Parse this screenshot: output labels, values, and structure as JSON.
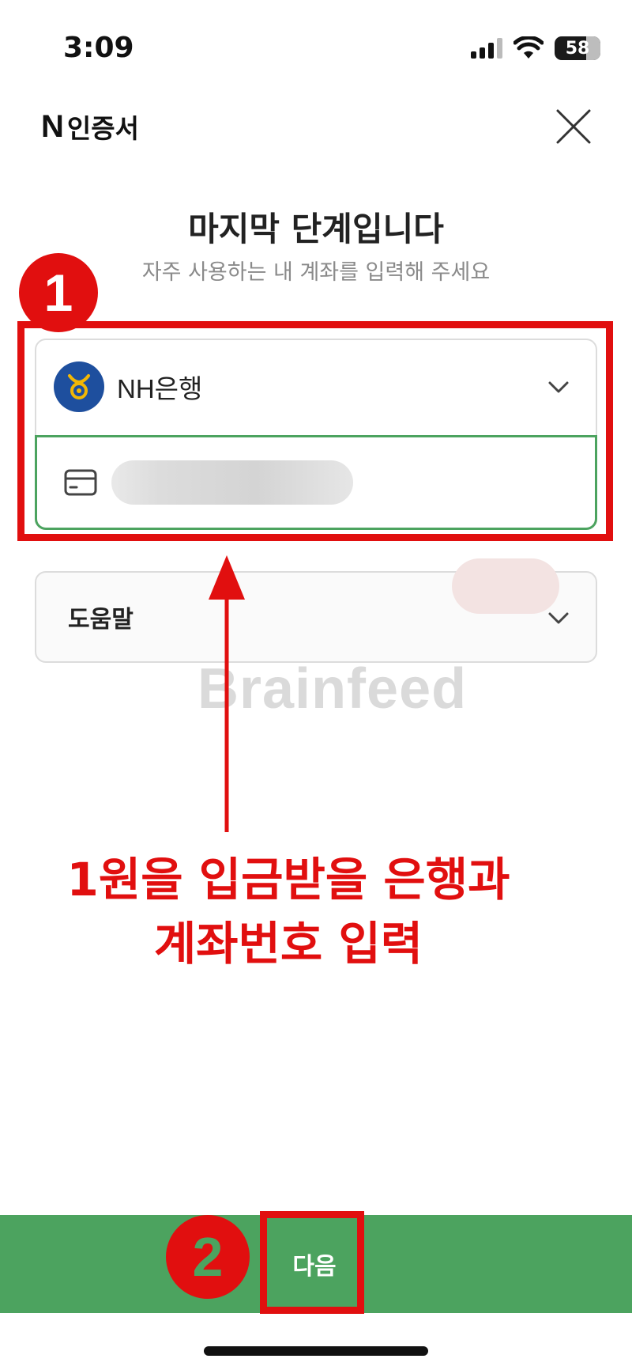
{
  "status_bar": {
    "time": "3:09",
    "battery": "58"
  },
  "header": {
    "logo_letter": "N",
    "title": "인증서"
  },
  "page": {
    "title": "마지막 단계입니다",
    "subtitle": "자주 사용하는 내 계좌를 입력해 주세요"
  },
  "form": {
    "bank_name": "NH은행",
    "account_number": ""
  },
  "help": {
    "label": "도움말"
  },
  "watermark": "Brainfeed",
  "annotations": {
    "badge_1": "1",
    "badge_2": "2",
    "caption_line1": "1원을 입금받을 은행과",
    "caption_line2": "계좌번호 입력",
    "color": "#e10f0f"
  },
  "footer": {
    "next_label": "다음"
  },
  "colors": {
    "accent_green": "#4ca35f",
    "bank_blue": "#1e4f9e",
    "bank_gold": "#f2b705"
  },
  "icons": [
    "signal-icon",
    "wifi-icon",
    "battery-icon",
    "close-icon",
    "bank-logo-icon",
    "chevron-down-icon",
    "card-icon"
  ]
}
